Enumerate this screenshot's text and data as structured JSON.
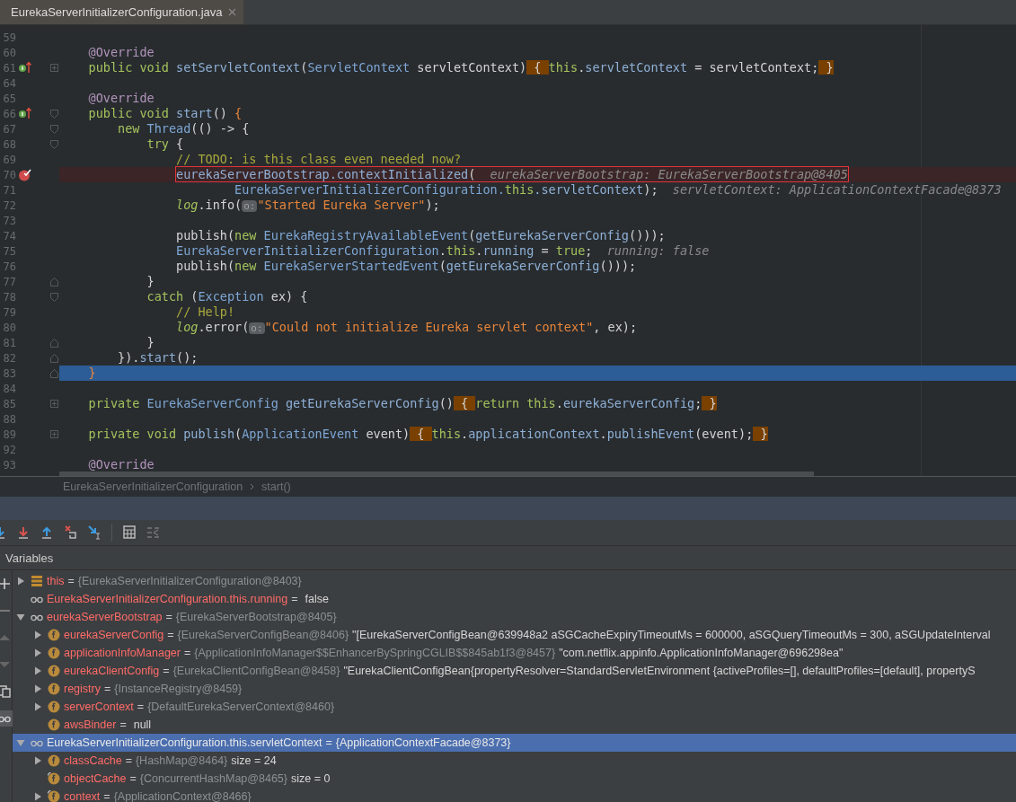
{
  "editor": {
    "tabs": [
      {
        "label": "EurekaServerInitializerConfiguration.java",
        "selected": true
      }
    ],
    "lines": [
      {
        "number": "59",
        "kind": "normal"
      },
      {
        "number": "60",
        "kind": "normal",
        "tokens": [
          {
            "kind": "anno",
            "text": "    @Override"
          }
        ]
      },
      {
        "number": "61",
        "kind": "normal",
        "gutter_icons": [
          {
            "kind": "override"
          },
          {
            "kind": "fold-collapsed"
          }
        ],
        "tokens": [
          {
            "kind": "kw",
            "text": "    public void "
          },
          {
            "kind": "method",
            "text": "setServletContext"
          },
          {
            "kind": "plain",
            "text": "("
          },
          {
            "kind": "type",
            "text": "ServletContext"
          },
          {
            "kind": "plain",
            "text": " servletContext)"
          },
          {
            "kind": "folded",
            "text": " { "
          },
          {
            "kind": "kw",
            "text": "this"
          },
          {
            "kind": "plain",
            "text": "."
          },
          {
            "kind": "field",
            "text": "servletContext"
          },
          {
            "kind": "plain",
            "text": " = servletContext;"
          },
          {
            "kind": "folded",
            "text": " }"
          }
        ]
      },
      {
        "number": "64",
        "kind": "normal"
      },
      {
        "number": "65",
        "kind": "normal",
        "tokens": [
          {
            "kind": "anno",
            "text": "    @Override"
          }
        ]
      },
      {
        "number": "66",
        "kind": "normal",
        "gutter_icons": [
          {
            "kind": "override"
          },
          {
            "kind": "fold-start"
          }
        ],
        "tokens": [
          {
            "kind": "kw",
            "text": "    public void "
          },
          {
            "kind": "method",
            "text": "start"
          },
          {
            "kind": "plain",
            "text": "() "
          },
          {
            "kind": "brace",
            "text": "{"
          }
        ]
      },
      {
        "number": "67",
        "kind": "normal",
        "gutter_icons": [
          {
            "kind": "fold-start"
          }
        ],
        "tokens": [
          {
            "kind": "kw",
            "text": "        new "
          },
          {
            "kind": "type",
            "text": "Thread"
          },
          {
            "kind": "plain",
            "text": "(() -> {"
          }
        ]
      },
      {
        "number": "68",
        "kind": "normal",
        "gutter_icons": [
          {
            "kind": "fold-start"
          }
        ],
        "tokens": [
          {
            "kind": "kw",
            "text": "            try "
          },
          {
            "kind": "plain",
            "text": "{"
          }
        ]
      },
      {
        "number": "69",
        "kind": "normal",
        "tokens": [
          {
            "kind": "comment",
            "text": "                // TODO: is this class even needed now?"
          }
        ]
      },
      {
        "number": "70",
        "kind": "breakpoint",
        "framed": true,
        "gutter_icons": [
          {
            "kind": "breakpoint"
          }
        ],
        "tokens": [
          {
            "kind": "field",
            "text": "                eurekaServerBootstrap"
          },
          {
            "kind": "method",
            "text": ".contextInitialized"
          },
          {
            "kind": "plain",
            "text": "("
          },
          {
            "kind": "hint",
            "text": "  eurekaServerBootstrap: EurekaServerBootstrap@8405"
          }
        ]
      },
      {
        "number": "71",
        "kind": "normal",
        "tokens": [
          {
            "kind": "type",
            "text": "                        EurekaServerInitializerConfiguration."
          },
          {
            "kind": "kw",
            "text": "this"
          },
          {
            "kind": "field",
            "text": ".servletContext"
          },
          {
            "kind": "plain",
            "text": ");"
          },
          {
            "kind": "hint",
            "text": "servletContext: ApplicationContextFacade@8373"
          }
        ]
      },
      {
        "number": "72",
        "kind": "normal",
        "tokens": [
          {
            "kind": "log",
            "text": "                log"
          },
          {
            "kind": "plain",
            "text": ".info("
          },
          {
            "kind": "pill",
            "text": "o:"
          },
          {
            "kind": "string",
            "text": "\"Started Eureka Server\""
          },
          {
            "kind": "plain",
            "text": ");"
          }
        ]
      },
      {
        "number": "73",
        "kind": "normal"
      },
      {
        "number": "74",
        "kind": "normal",
        "tokens": [
          {
            "kind": "plain",
            "text": "                publish("
          },
          {
            "kind": "kw",
            "text": "new "
          },
          {
            "kind": "type",
            "text": "EurekaRegistryAvailableEvent"
          },
          {
            "kind": "plain",
            "text": "("
          },
          {
            "kind": "method",
            "text": "getEurekaServerConfig"
          },
          {
            "kind": "plain",
            "text": "()));"
          }
        ]
      },
      {
        "number": "75",
        "kind": "normal",
        "tokens": [
          {
            "kind": "type",
            "text": "                EurekaServerInitializerConfiguration"
          },
          {
            "kind": "plain",
            "text": "."
          },
          {
            "kind": "kw",
            "text": "this"
          },
          {
            "kind": "plain",
            "text": "."
          },
          {
            "kind": "field",
            "text": "running"
          },
          {
            "kind": "plain",
            "text": " = "
          },
          {
            "kind": "kw",
            "text": "true"
          },
          {
            "kind": "plain",
            "text": ";"
          },
          {
            "kind": "hint",
            "text": "running: false"
          }
        ]
      },
      {
        "number": "76",
        "kind": "normal",
        "tokens": [
          {
            "kind": "plain",
            "text": "                publish("
          },
          {
            "kind": "kw",
            "text": "new "
          },
          {
            "kind": "type",
            "text": "EurekaServerStartedEvent"
          },
          {
            "kind": "plain",
            "text": "("
          },
          {
            "kind": "method",
            "text": "getEurekaServerConfig"
          },
          {
            "kind": "plain",
            "text": "()));"
          }
        ]
      },
      {
        "number": "77",
        "kind": "normal",
        "gutter_icons": [
          {
            "kind": "fold-end"
          }
        ],
        "tokens": [
          {
            "kind": "plain",
            "text": "            }"
          }
        ]
      },
      {
        "number": "78",
        "kind": "normal",
        "gutter_icons": [
          {
            "kind": "fold-start"
          }
        ],
        "tokens": [
          {
            "kind": "kw",
            "text": "            catch "
          },
          {
            "kind": "plain",
            "text": "("
          },
          {
            "kind": "type",
            "text": "Exception"
          },
          {
            "kind": "plain",
            "text": " ex) {"
          }
        ]
      },
      {
        "number": "79",
        "kind": "normal",
        "tokens": [
          {
            "kind": "comment",
            "text": "                // Help!"
          }
        ]
      },
      {
        "number": "80",
        "kind": "normal",
        "tokens": [
          {
            "kind": "log",
            "text": "                log"
          },
          {
            "kind": "plain",
            "text": ".error("
          },
          {
            "kind": "pill",
            "text": "o:"
          },
          {
            "kind": "string",
            "text": "\"Could not initialize Eureka servlet context\""
          },
          {
            "kind": "plain",
            "text": ", ex);"
          }
        ]
      },
      {
        "number": "81",
        "kind": "normal",
        "gutter_icons": [
          {
            "kind": "fold-end"
          }
        ],
        "tokens": [
          {
            "kind": "plain",
            "text": "            }"
          }
        ]
      },
      {
        "number": "82",
        "kind": "normal",
        "gutter_icons": [
          {
            "kind": "fold-end"
          }
        ],
        "tokens": [
          {
            "kind": "plain",
            "text": "        })."
          },
          {
            "kind": "method",
            "text": "start"
          },
          {
            "kind": "plain",
            "text": "();"
          }
        ]
      },
      {
        "number": "83",
        "kind": "execution",
        "gutter_icons": [
          {
            "kind": "fold-end"
          }
        ],
        "tokens": [
          {
            "kind": "brace",
            "text": "    }"
          }
        ]
      },
      {
        "number": "84",
        "kind": "normal"
      },
      {
        "number": "85",
        "kind": "normal",
        "gutter_icons": [
          {
            "kind": "fold-collapsed"
          }
        ],
        "tokens": [
          {
            "kind": "kw",
            "text": "    private "
          },
          {
            "kind": "type",
            "text": "EurekaServerConfig"
          },
          {
            "kind": "method",
            "text": " getEurekaServerConfig"
          },
          {
            "kind": "plain",
            "text": "()"
          },
          {
            "kind": "folded",
            "text": " { "
          },
          {
            "kind": "kw",
            "text": "return this"
          },
          {
            "kind": "plain",
            "text": "."
          },
          {
            "kind": "field",
            "text": "eurekaServerConfig"
          },
          {
            "kind": "plain",
            "text": ";"
          },
          {
            "kind": "folded",
            "text": " }"
          }
        ]
      },
      {
        "number": "88",
        "kind": "normal"
      },
      {
        "number": "89",
        "kind": "normal",
        "gutter_icons": [
          {
            "kind": "fold-collapsed"
          }
        ],
        "tokens": [
          {
            "kind": "kw",
            "text": "    private void "
          },
          {
            "kind": "method",
            "text": "publish"
          },
          {
            "kind": "plain",
            "text": "("
          },
          {
            "kind": "type",
            "text": "ApplicationEvent"
          },
          {
            "kind": "plain",
            "text": " event)"
          },
          {
            "kind": "folded",
            "text": " { "
          },
          {
            "kind": "kw",
            "text": "this"
          },
          {
            "kind": "plain",
            "text": "."
          },
          {
            "kind": "field",
            "text": "applicationContext"
          },
          {
            "kind": "plain",
            "text": "."
          },
          {
            "kind": "method",
            "text": "publishEvent"
          },
          {
            "kind": "plain",
            "text": "(event);"
          },
          {
            "kind": "folded",
            "text": " }"
          }
        ]
      },
      {
        "number": "92",
        "kind": "normal"
      },
      {
        "number": "93",
        "kind": "normal",
        "tokens": [
          {
            "kind": "anno",
            "text": "    @Override"
          }
        ]
      }
    ]
  },
  "breadcrumb": [
    {
      "label": "EurekaServerInitializerConfiguration"
    },
    {
      "label": "start()"
    }
  ],
  "debugger": {
    "toolbar": [
      {
        "kind": "step-over"
      },
      {
        "kind": "step-into"
      },
      {
        "kind": "step-out"
      },
      {
        "kind": "drop-frame"
      },
      {
        "kind": "run-to-cursor"
      },
      {
        "kind": "separator"
      },
      {
        "kind": "evaluate"
      },
      {
        "kind": "trace"
      }
    ],
    "side_tools": [
      {
        "kind": "add",
        "selected": false
      },
      {
        "kind": "remove",
        "selected": false
      },
      {
        "kind": "up",
        "selected": false
      },
      {
        "kind": "down",
        "selected": false
      },
      {
        "kind": "copy",
        "selected": false
      },
      {
        "kind": "watches",
        "selected": true
      }
    ],
    "variables_title": "Variables",
    "variables": [
      {
        "kind": "object",
        "expanded": false,
        "selected": false,
        "name": "this",
        "eq": "=",
        "ref": "{EurekaServerInitializerConfiguration@8403}"
      },
      {
        "kind": "watch",
        "selected": false,
        "name": "EurekaServerInitializerConfiguration.this.running",
        "eq": "=",
        "value": "false"
      },
      {
        "kind": "watch",
        "expanded": true,
        "selected": false,
        "name": "eurekaServerBootstrap",
        "eq": "=",
        "ref": "{EurekaServerBootstrap@8405}",
        "children": [
          {
            "kind": "field",
            "expanded": false,
            "selected": false,
            "name": "eurekaServerConfig",
            "eq": "=",
            "ref": "{EurekaServerConfigBean@8406}",
            "value": "\"[EurekaServerConfigBean@639948a2 aSGCacheExpiryTimeoutMs = 600000, aSGQueryTimeoutMs = 300, aSGUpdateInterval"
          },
          {
            "kind": "field",
            "expanded": false,
            "selected": false,
            "name": "applicationInfoManager",
            "eq": "=",
            "ref": "{ApplicationInfoManager$$EnhancerBySpringCGLIB$$845ab1f3@8457}",
            "value": "\"com.netflix.appinfo.ApplicationInfoManager@696298ea\""
          },
          {
            "kind": "field",
            "expanded": false,
            "selected": false,
            "name": "eurekaClientConfig",
            "eq": "=",
            "ref": "{EurekaClientConfigBean@8458}",
            "value": "\"EurekaClientConfigBean{propertyResolver=StandardServletEnvironment {activeProfiles=[], defaultProfiles=[default], propertyS"
          },
          {
            "kind": "field",
            "expanded": false,
            "selected": false,
            "name": "registry",
            "eq": "=",
            "ref": "{InstanceRegistry@8459}"
          },
          {
            "kind": "field",
            "expanded": false,
            "selected": false,
            "name": "serverContext",
            "eq": "=",
            "ref": "{DefaultEurekaServerContext@8460}"
          },
          {
            "kind": "field",
            "selected": false,
            "name": "awsBinder",
            "eq": "=",
            "value": "null"
          }
        ]
      },
      {
        "kind": "watch",
        "expanded": true,
        "selected": true,
        "name": "EurekaServerInitializerConfiguration.this.servletContext",
        "eq": "=",
        "ref": "{ApplicationContextFacade@8373}",
        "children": [
          {
            "kind": "field",
            "expanded": false,
            "selected": false,
            "name": "classCache",
            "eq": "=",
            "ref": "{HashMap@8464}",
            "value": "size = 24"
          },
          {
            "kind": "final-field",
            "selected": false,
            "name": "objectCache",
            "eq": "=",
            "ref": "{ConcurrentHashMap@8465}",
            "value": "size = 0"
          },
          {
            "kind": "final-field",
            "expanded": false,
            "selected": false,
            "name": "context",
            "eq": "=",
            "ref": "{ApplicationContext@8466}"
          }
        ]
      }
    ]
  }
}
